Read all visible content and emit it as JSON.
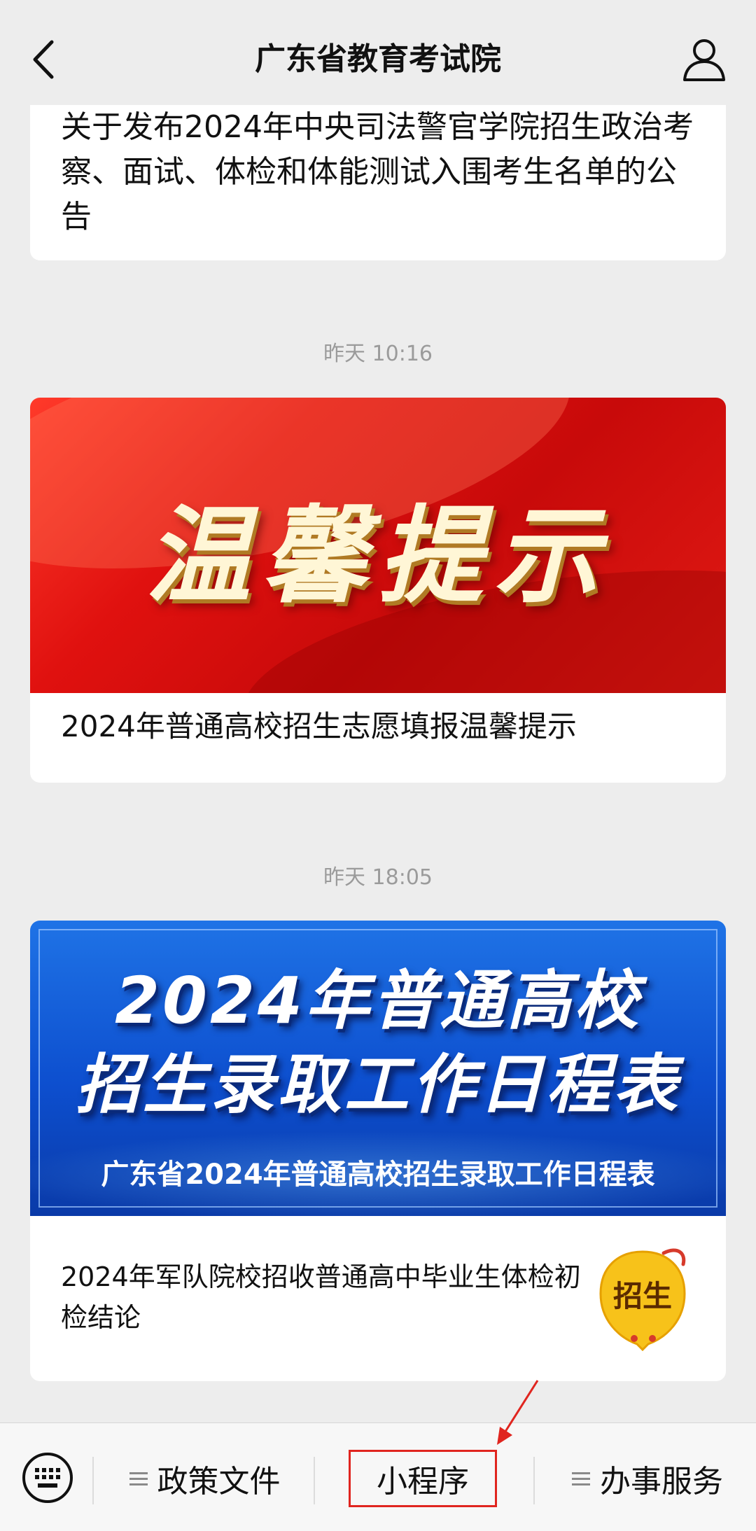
{
  "header": {
    "title": "广东省教育考试院"
  },
  "cards": [
    {
      "text": "关于发布2024年中央司法警官学院招生政治考察、面试、体检和体能测试入围考生名单的公告"
    },
    {
      "timestamp": "昨天 10:16",
      "banner_text": "温馨提示",
      "caption": "2024年普通高校招生志愿填报温馨提示"
    },
    {
      "timestamp": "昨天 18:05",
      "banner_line1": "2024年普通高校",
      "banner_line2": "招生录取工作日程表",
      "banner_sub": "广东省2024年普通高校招生录取工作日程表",
      "caption": "2024年军队院校招收普通高中毕业生体检初检结论",
      "badge": "招生"
    }
  ],
  "bottom_menu": {
    "items": [
      {
        "label": "政策文件",
        "icon": "menu-lines-icon"
      },
      {
        "label": "小程序",
        "highlighted": true
      },
      {
        "label": "办事服务",
        "icon": "menu-lines-icon"
      }
    ]
  },
  "colors": {
    "highlight": "#e0251f",
    "red_banner": "#d40f0e",
    "blue_banner": "#0d4fcf",
    "badge": "#f7c21a"
  }
}
